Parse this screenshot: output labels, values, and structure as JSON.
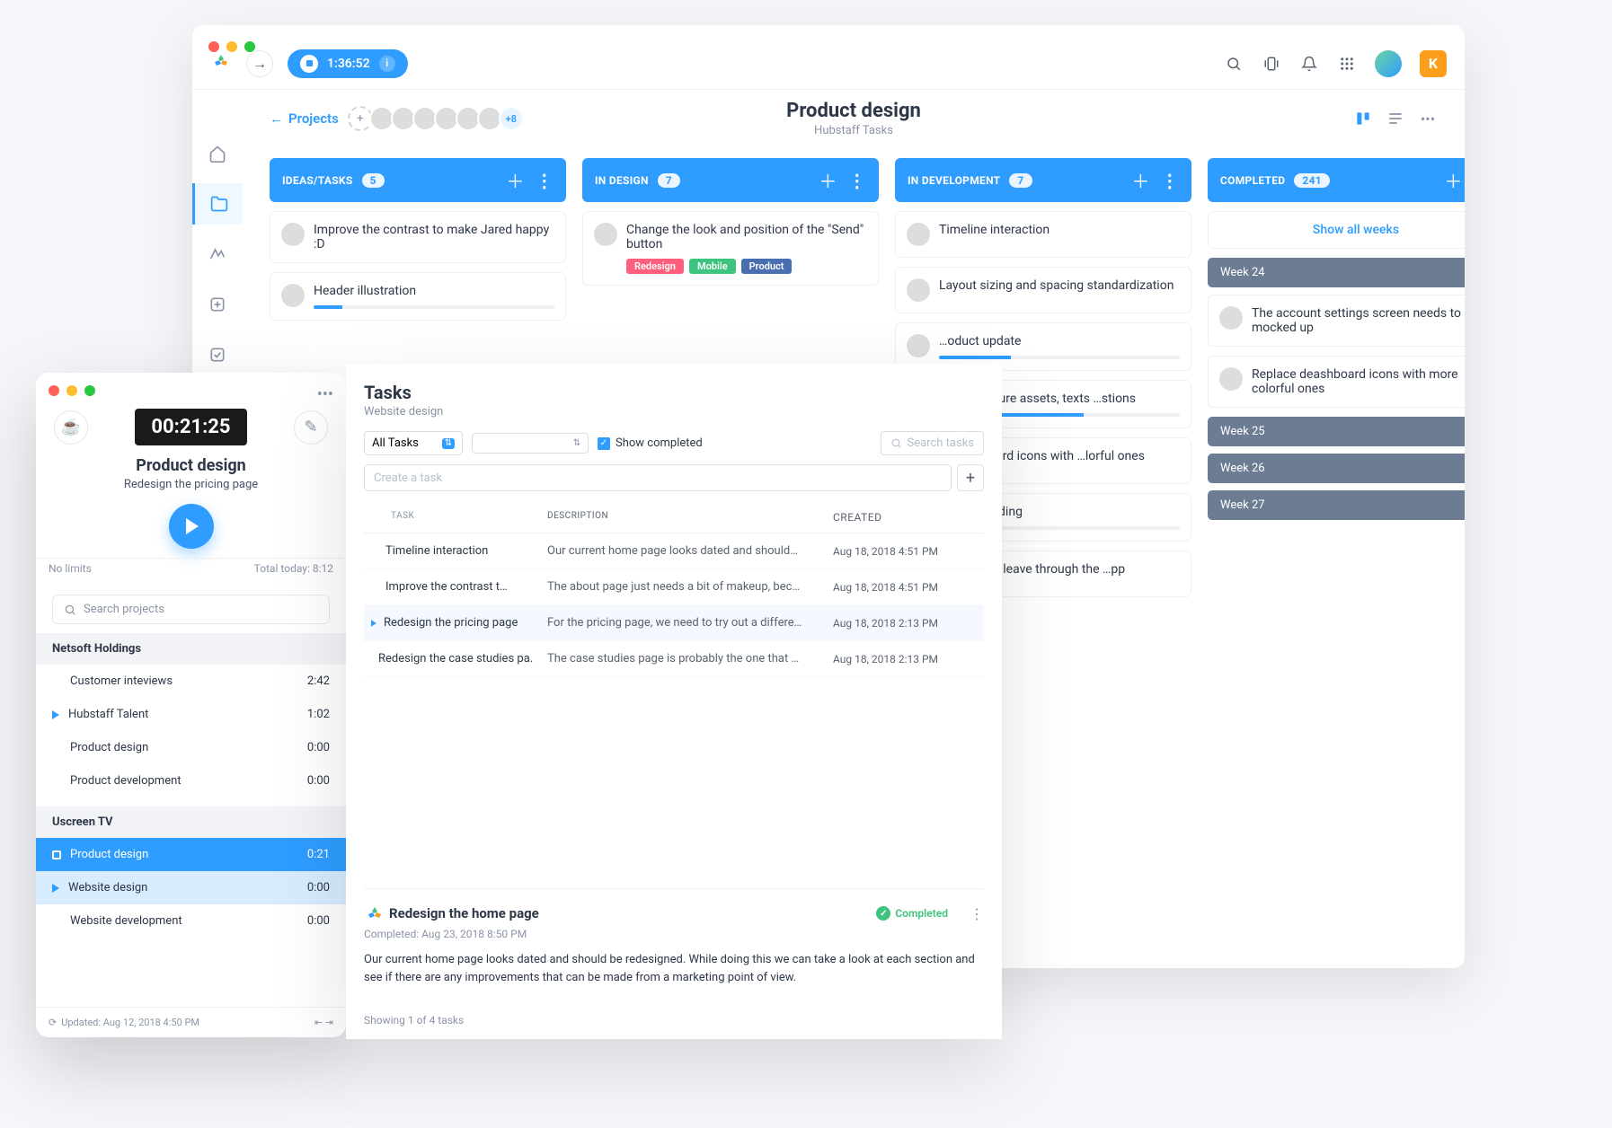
{
  "topbar": {
    "timer": "1:36:52",
    "badge": "K"
  },
  "breadcrumb": {
    "back": "Projects",
    "title": "Product design",
    "subtitle": "Hubstaff Tasks",
    "more_avatars": "+8"
  },
  "columns": [
    {
      "name": "IDEAS/TASKS",
      "count": "5",
      "cards": [
        {
          "text": "Improve the contrast to make Jared happy :D",
          "avatar": "av2"
        },
        {
          "text": "Header illustration",
          "avatar": "av1",
          "progress": 12
        }
      ]
    },
    {
      "name": "IN DESIGN",
      "count": "7",
      "cards": [
        {
          "text": "Change the look and position of the \"Send\" button",
          "avatar": "av3",
          "labels": [
            "Redesign",
            "Mobile",
            "Product"
          ]
        }
      ]
    },
    {
      "name": "IN DEVELOPMENT",
      "count": "7",
      "cards": [
        {
          "text": "Timeline interaction",
          "avatar": "av4"
        },
        {
          "text": "Layout sizing and spacing standardization",
          "avatar": "av5"
        },
        {
          "text": "…oduct update",
          "avatar": "av1",
          "progress": 30
        },
        {
          "text": "…eaks feature assets, texts …stions",
          "avatar": "av2",
          "progress": 60
        },
        {
          "text": "…deashboard icons with …lorful ones",
          "avatar": "av3"
        },
        {
          "text": "Routes loading",
          "avatar": "av4",
          "progress": 8
        },
        {
          "text": "…o request leave through the …pp",
          "avatar": "av5"
        }
      ]
    },
    {
      "name": "COMPLETED",
      "count": "241"
    }
  ],
  "completed": {
    "show_all": "Show all weeks",
    "weeks": [
      "Week 24",
      "Week 25",
      "Week 26",
      "Week 27"
    ],
    "week24_cards": [
      {
        "text": "The account settings screen needs to be mocked up",
        "avatar": "av3"
      },
      {
        "text": "Replace deashboard icons with more colorful ones",
        "avatar": "av1"
      }
    ]
  },
  "tracker": {
    "timer": "00:21:25",
    "project": "Product design",
    "task": "Redesign the pricing page",
    "no_limits": "No limits",
    "total_today": "Total today: 8:12",
    "search_ph": "Search projects",
    "groups": [
      {
        "name": "Netsoft Holdings",
        "items": [
          {
            "name": "Customer inteviews",
            "time": "2:42"
          },
          {
            "name": "Hubstaff Talent",
            "time": "1:02",
            "playing": true
          },
          {
            "name": "Product design",
            "time": "0:00"
          },
          {
            "name": "Product development",
            "time": "0:00"
          }
        ]
      },
      {
        "name": "Uscreen TV",
        "items": [
          {
            "name": "Product design",
            "time": "0:21",
            "selected": true
          },
          {
            "name": "Website design",
            "time": "0:00",
            "sub": true
          },
          {
            "name": "Website development",
            "time": "0:00"
          }
        ]
      }
    ],
    "updated": "Updated: Aug 12, 2018 4:50 PM"
  },
  "tasks": {
    "title": "Tasks",
    "subtitle": "Website design",
    "filter": "All Tasks",
    "show_completed": "Show completed",
    "search_ph": "Search tasks",
    "create_ph": "Create a task",
    "headers": {
      "task": "TASK",
      "desc": "DESCRIPTION",
      "created": "CREATED"
    },
    "rows": [
      {
        "task": "Timeline interaction",
        "desc": "Our current home page looks dated and should…",
        "created": "Aug 18, 2018 4:51 PM"
      },
      {
        "task": "Improve the contrast t…",
        "desc": "The about page just needs a bit of makeup, bec…",
        "created": "Aug 18, 2018 4:51 PM"
      },
      {
        "task": "Redesign the pricing page",
        "desc": "For the pricing page, we need to try out a differe…",
        "created": "Aug 18, 2018 2:13 PM",
        "active": true
      },
      {
        "task": "Redesign the case studies pa…",
        "desc": "The case studies page is probably the one that …",
        "created": "Aug 18, 2018 2:13 PM"
      }
    ],
    "detail": {
      "title": "Redesign the home page",
      "status": "Completed",
      "meta": "Completed: Aug 23, 2018 8:50 PM",
      "body": "Our current home page looks dated and should be redesigned. While doing this we can take a look at each section and see if there are any improvements that can be made from a marketing point of view."
    },
    "footer": "Showing 1 of 4 tasks"
  }
}
